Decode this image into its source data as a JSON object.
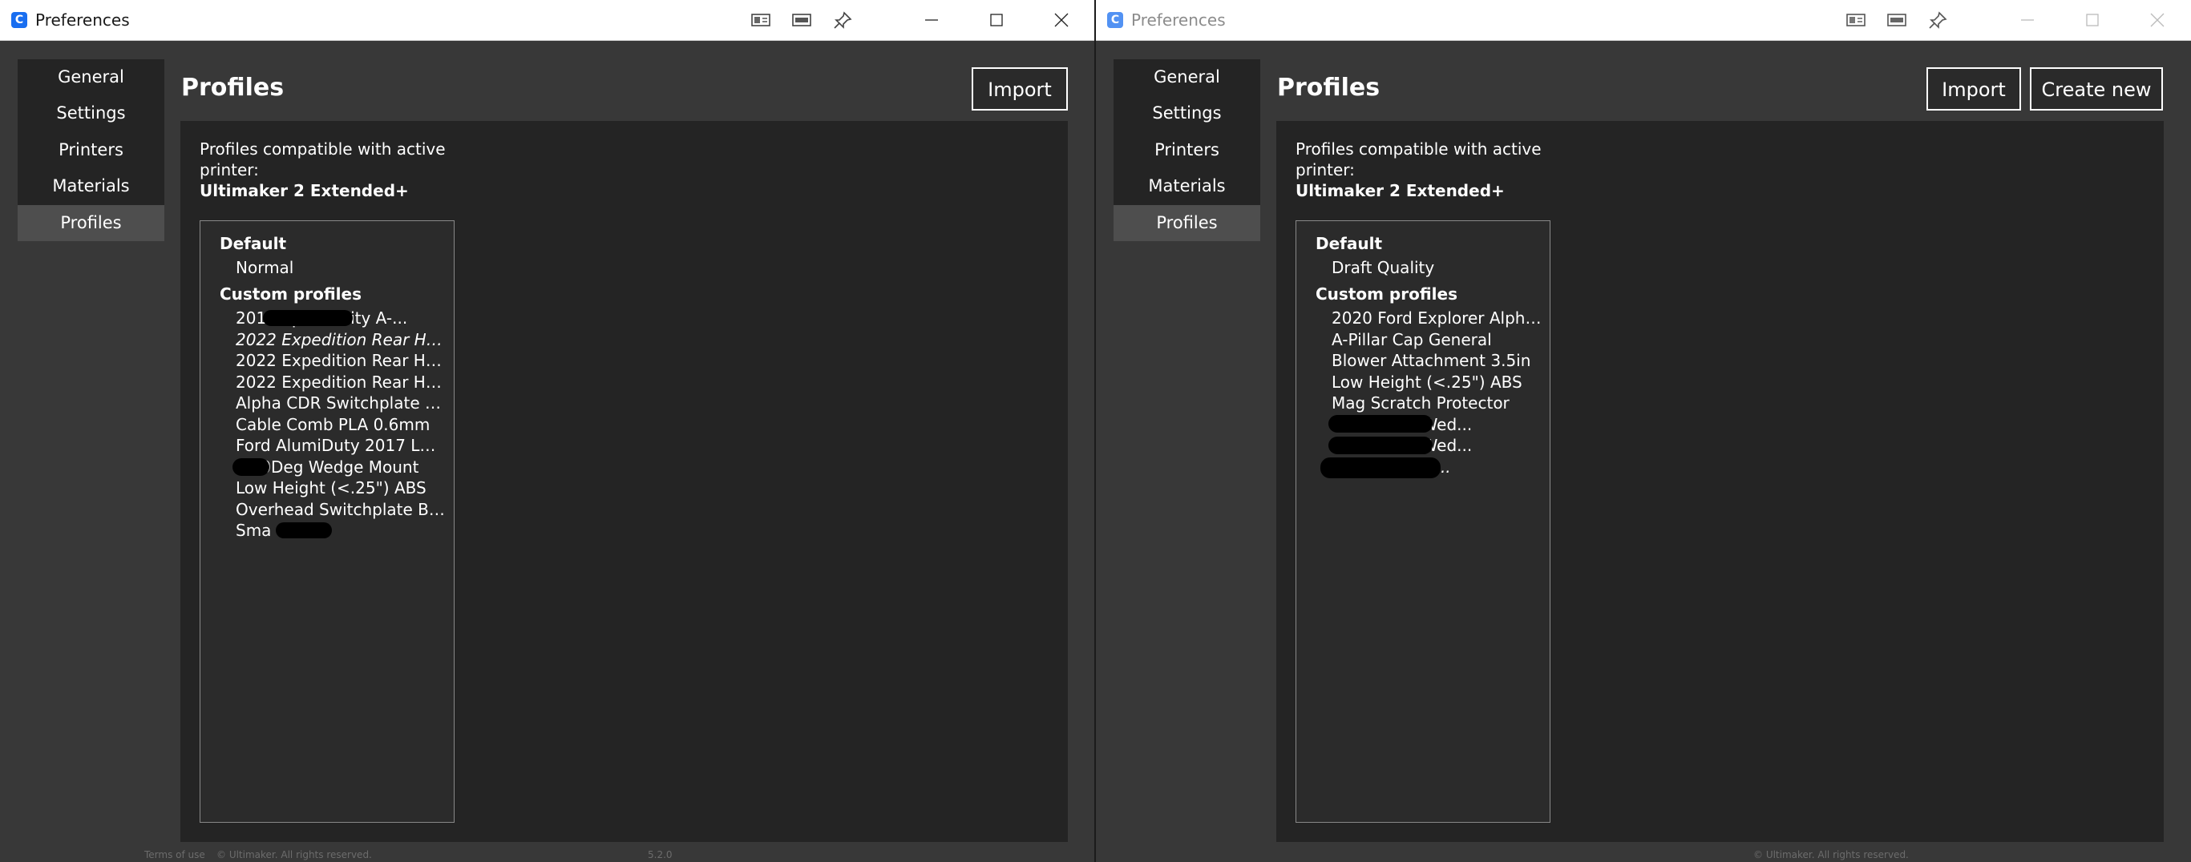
{
  "left_window": {
    "title": "Preferences",
    "app_icon_glyph": "C",
    "sidebar": [
      {
        "label": "General"
      },
      {
        "label": "Settings"
      },
      {
        "label": "Printers"
      },
      {
        "label": "Materials"
      },
      {
        "label": "Profiles",
        "active": true
      }
    ],
    "page_title": "Profiles",
    "buttons": {
      "import": "Import"
    },
    "compat_line1": "Profiles compatible with active",
    "compat_line2": "printer:",
    "printer_name": "Ultimaker 2 Extended+",
    "default_header": "Default",
    "default_profiles": [
      "Normal"
    ],
    "custom_header": "Custom profiles",
    "custom_profiles": [
      {
        "label": "201      Super Utility A-...",
        "italic": false
      },
      {
        "label": "2022 Expedition Rear Hatc...",
        "italic": true
      },
      {
        "label": "2022 Expedition Rear Hat...",
        "italic": false
      },
      {
        "label": "2022 Expedition Rear Hat...",
        "italic": false
      },
      {
        "label": "Alpha CDR Switchplate 2B...",
        "italic": false
      },
      {
        "label": "Cable Comb PLA 0.6mm",
        "italic": false
      },
      {
        "label": "Ford AlumiDuty 2017 L10...",
        "italic": false
      },
      {
        "label": "      T 60Deg Wedge Mount",
        "italic": false
      },
      {
        "label": "Low Height (<.25\") ABS",
        "italic": false
      },
      {
        "label": "Overhead Switchplate Bla...",
        "italic": false
      },
      {
        "label": "Sma        Cover",
        "italic": false
      }
    ],
    "footer": [
      "Terms of use",
      "© Ultimaker. All rights reserved.",
      "5.2.0"
    ]
  },
  "right_window": {
    "title": "Preferences",
    "app_icon_glyph": "C",
    "sidebar": [
      {
        "label": "General"
      },
      {
        "label": "Settings"
      },
      {
        "label": "Printers"
      },
      {
        "label": "Materials"
      },
      {
        "label": "Profiles",
        "active": true
      }
    ],
    "page_title": "Profiles",
    "buttons": {
      "import": "Import",
      "create_new": "Create new"
    },
    "compat_line1": "Profiles compatible with active",
    "compat_line2": "printer:",
    "printer_name": "Ultimaker 2 Extended+",
    "default_header": "Default",
    "default_profiles": [
      "Draft Quality"
    ],
    "custom_header": "Custom profiles",
    "custom_profiles": [
      {
        "label": "2020 Ford Explorer Alpha ...",
        "italic": false
      },
      {
        "label": "A-Pillar Cap General",
        "italic": false
      },
      {
        "label": "Blower Attachment 3.5in",
        "italic": false
      },
      {
        "label": "Low Height (<.25\") ABS",
        "italic": false
      },
      {
        "label": "Mag Scratch Protector",
        "italic": false
      },
      {
        "label": "W            T Series Wed...",
        "italic": false
      },
      {
        "label": "W            T Series Wed...",
        "italic": false
      },
      {
        "label": "               ite Plus 15de...",
        "italic": true
      }
    ],
    "footer": [
      "© Ultimaker. All rights reserved."
    ]
  },
  "icons": {
    "app": "cura-app-icon",
    "tool1": "window-layout-icon",
    "tool2": "window-tile-icon",
    "tool3": "pin-icon",
    "minimize": "minimize-icon",
    "maximize": "maximize-icon",
    "close": "close-icon"
  },
  "colors": {
    "window_bg": "#383838",
    "panel_bg": "#242424",
    "sidebar_active": "#4e4e4e",
    "title_bar": "#ffffff",
    "app_icon": "#196ef0",
    "text": "#ffffff"
  }
}
